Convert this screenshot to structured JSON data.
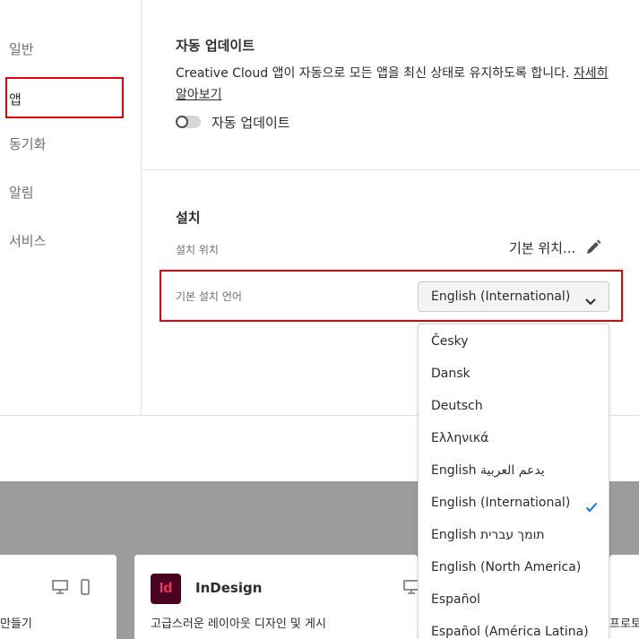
{
  "sidebar": {
    "items": [
      {
        "label": "일반"
      },
      {
        "label": "앱"
      },
      {
        "label": "동기화"
      },
      {
        "label": "알림"
      },
      {
        "label": "서비스"
      }
    ]
  },
  "auto_update": {
    "title": "자동 업데이트",
    "description": "Creative Cloud 앱이 자동으로 모든 앱을 최신 상태로 유지하도록 합니다. ",
    "learn_more_line1": "자세히",
    "learn_more_line2": "알아보기",
    "toggle_label": "자동 업데이트"
  },
  "install": {
    "title": "설치",
    "location_label": "설치 위치",
    "location_value": "기본 위치...",
    "language_label": "기본 설치 언어",
    "language_value": "English (International)",
    "options": [
      "Česky",
      "Dansk",
      "Deutsch",
      "Ελληνικά",
      "English يدعم العربية",
      "English (International)",
      "English תומך עברית",
      "English (North America)",
      "Español",
      "Español (América Latina)"
    ],
    "selected_index": 5
  },
  "apps": {
    "left_partial_text": "만들기",
    "indesign": {
      "logo": "Id",
      "name": "InDesign",
      "description": "고급스러운 레이아웃 디자인 및 게시"
    },
    "right_partial_text": "프로토타입"
  },
  "colors": {
    "highlight": "#e3000f",
    "check": "#1473e6",
    "indesign_bg": "#49021f",
    "indesign_fg": "#ff3366"
  }
}
